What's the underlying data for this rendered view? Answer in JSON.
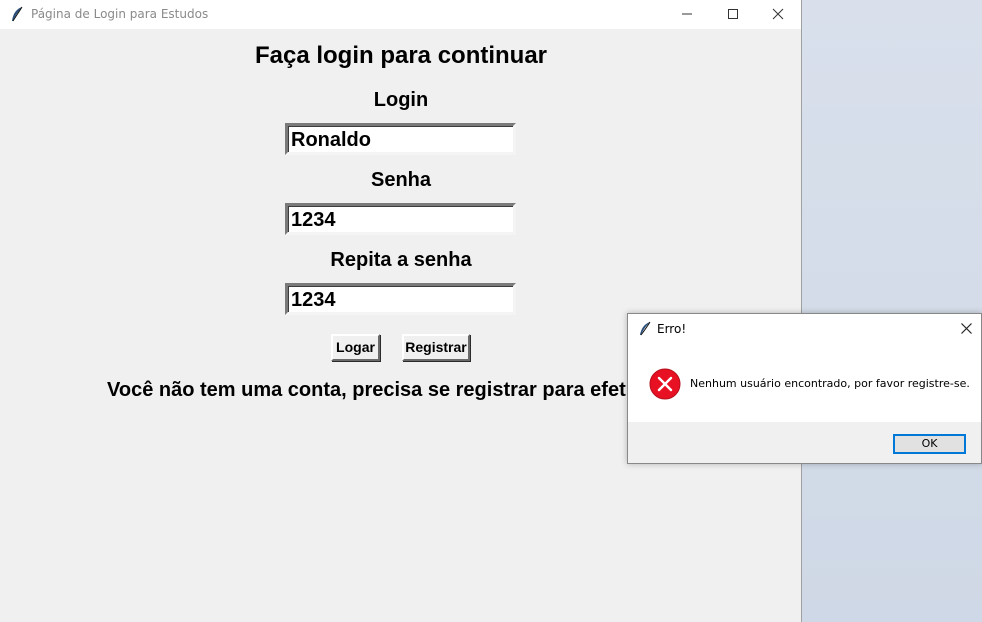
{
  "window": {
    "title": "Página de Login para Estudos",
    "icon": "tk-feather-icon"
  },
  "form": {
    "heading": "Faça login para continuar",
    "login_label": "Login",
    "login_value": "Ronaldo",
    "password_label": "Senha",
    "password_value": "1234",
    "repeat_label": "Repita a senha",
    "repeat_value": "1234",
    "login_button": "Logar",
    "register_button": "Registrar",
    "info_message": "Você não tem uma conta, precisa se registrar para efetuar o login."
  },
  "dialog": {
    "title": "Erro!",
    "message": "Nenhum usuário encontrado, por favor registre-se.",
    "ok_button": "OK",
    "icon": "error-icon",
    "accent_color": "#0078d7",
    "error_color": "#e81123"
  }
}
